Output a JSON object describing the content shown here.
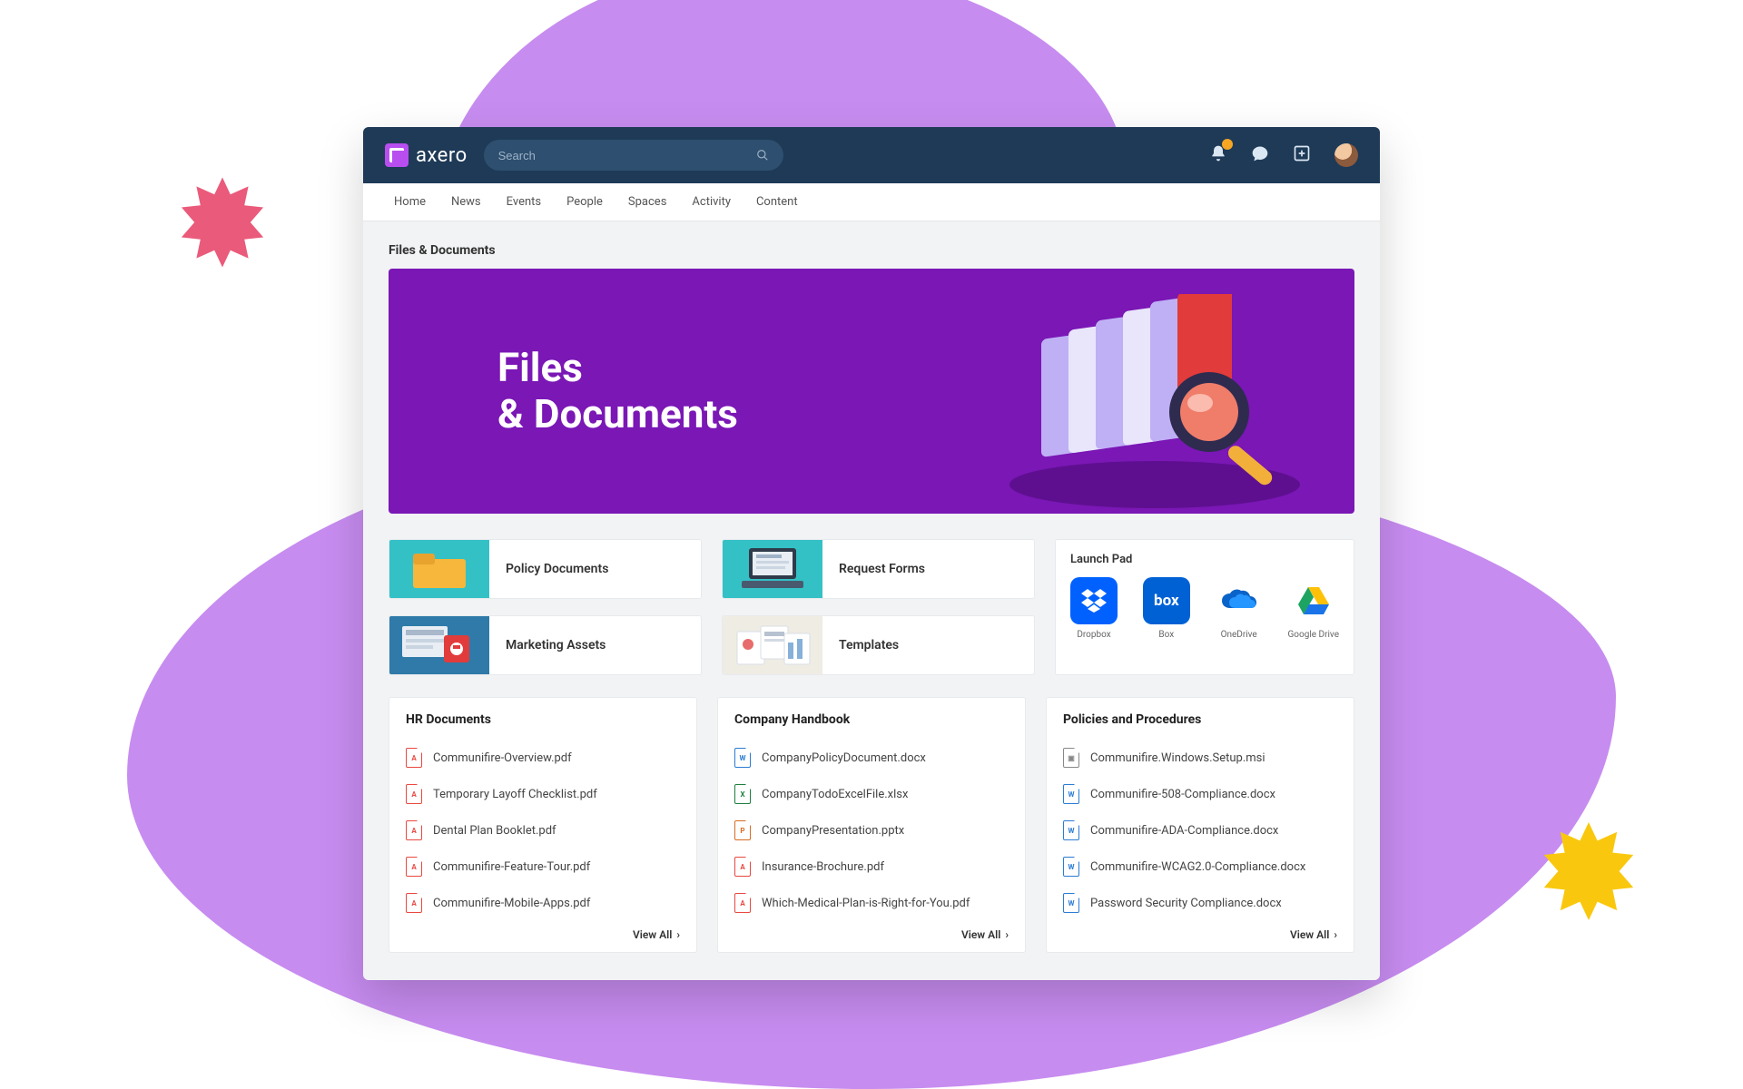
{
  "brand": "axero",
  "search": {
    "placeholder": "Search"
  },
  "nav": [
    "Home",
    "News",
    "Events",
    "People",
    "Spaces",
    "Activity",
    "Content"
  ],
  "section_title": "Files & Documents",
  "hero": {
    "line1": "Files",
    "line2": "& Documents"
  },
  "tiles": [
    {
      "label": "Policy Documents",
      "bg": "#34c1c6",
      "art": "folder"
    },
    {
      "label": "Request Forms",
      "bg": "#34c1c6",
      "art": "laptop"
    },
    {
      "label": "Marketing Assets",
      "bg": "#2f7aa8",
      "art": "assets"
    },
    {
      "label": "Templates",
      "bg": "#efece4",
      "art": "pages"
    }
  ],
  "launchpad": {
    "title": "Launch Pad",
    "items": [
      {
        "label": "Dropbox",
        "color": "#0061ff",
        "kind": "dropbox"
      },
      {
        "label": "Box",
        "color": "#0061d5",
        "kind": "box"
      },
      {
        "label": "OneDrive",
        "color": "#ffffff",
        "kind": "onedrive"
      },
      {
        "label": "Google Drive",
        "color": "#ffffff",
        "kind": "gdrive"
      }
    ]
  },
  "columns": [
    {
      "title": "HR Documents",
      "files": [
        {
          "name": "Communifire-Overview.pdf",
          "type": "pdf"
        },
        {
          "name": "Temporary Layoff Checklist.pdf",
          "type": "pdf"
        },
        {
          "name": "Dental Plan Booklet.pdf",
          "type": "pdf"
        },
        {
          "name": "Communifire-Feature-Tour.pdf",
          "type": "pdf"
        },
        {
          "name": "Communifire-Mobile-Apps.pdf",
          "type": "pdf"
        }
      ]
    },
    {
      "title": "Company Handbook",
      "files": [
        {
          "name": "CompanyPolicyDocument.docx",
          "type": "doc"
        },
        {
          "name": "CompanyTodoExcelFile.xlsx",
          "type": "xls"
        },
        {
          "name": "CompanyPresentation.pptx",
          "type": "ppt"
        },
        {
          "name": "Insurance-Brochure.pdf",
          "type": "pdf"
        },
        {
          "name": "Which-Medical-Plan-is-Right-for-You.pdf",
          "type": "pdf"
        }
      ]
    },
    {
      "title": "Policies and Procedures",
      "files": [
        {
          "name": "Communifire.Windows.Setup.msi",
          "type": "msi"
        },
        {
          "name": "Communifire-508-Compliance.docx",
          "type": "doc"
        },
        {
          "name": "Communifire-ADA-Compliance.docx",
          "type": "doc"
        },
        {
          "name": "Communifire-WCAG2.0-Compliance.docx",
          "type": "doc"
        },
        {
          "name": "Password Security Compliance.docx",
          "type": "doc"
        }
      ]
    }
  ],
  "view_all": "View All",
  "colors": {
    "pdf": "#e9483f",
    "doc": "#2b7cd3",
    "xls": "#1e7f3e",
    "ppt": "#d96b1f",
    "msi": "#888888"
  }
}
